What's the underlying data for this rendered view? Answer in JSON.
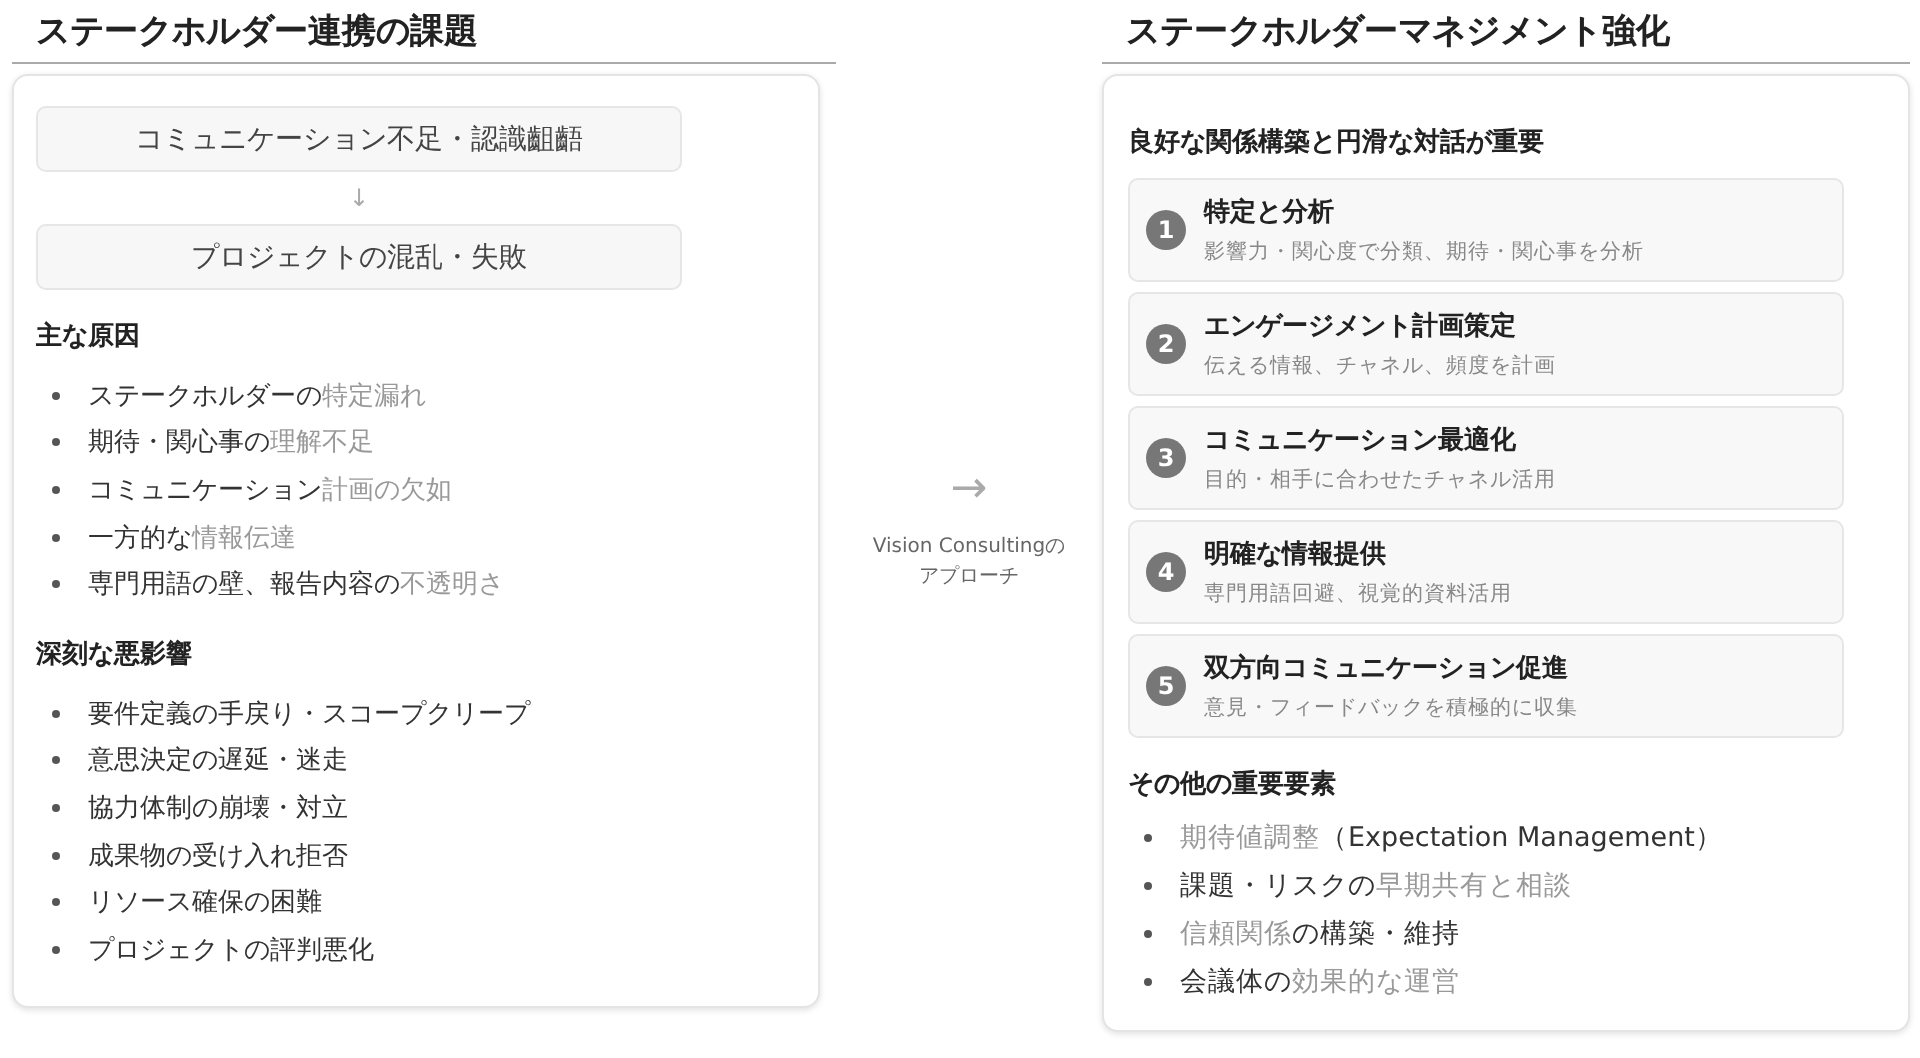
{
  "challenges": {
    "title": "ステークホルダー連携の課題",
    "flow": [
      "コミュニケーション不足・認識齟齬",
      "プロジェクトの混乱・失敗"
    ],
    "flow_arrow": "↓",
    "sections": [
      {
        "heading": "主な原因",
        "items": [
          [
            {
              "text": "ステークホルダーの",
              "highlight": false
            },
            {
              "text": "特定漏れ",
              "highlight": true
            }
          ],
          [
            {
              "text": "期待・関心事の",
              "highlight": false
            },
            {
              "text": "理解不足",
              "highlight": true
            }
          ],
          [
            {
              "text": "コミュニケーション",
              "highlight": false
            },
            {
              "text": "計画の欠如",
              "highlight": true
            }
          ],
          [
            {
              "text": "一方的な",
              "highlight": false
            },
            {
              "text": "情報伝達",
              "highlight": true
            }
          ],
          [
            {
              "text": "専門用語の壁、報告内容の",
              "highlight": false
            },
            {
              "text": "不透明さ",
              "highlight": true
            }
          ]
        ]
      },
      {
        "heading": "深刻な悪影響",
        "items": [
          [
            {
              "text": "要件定義の手戻り・スコープクリープ",
              "highlight": false
            }
          ],
          [
            {
              "text": "意思決定の遅延・迷走",
              "highlight": false
            }
          ],
          [
            {
              "text": "協力体制の崩壊・対立",
              "highlight": false
            }
          ],
          [
            {
              "text": "成果物の受け入れ拒否",
              "highlight": false
            }
          ],
          [
            {
              "text": "リソース確保の困難",
              "highlight": false
            }
          ],
          [
            {
              "text": "プロジェクトの評判悪化",
              "highlight": false
            }
          ]
        ]
      }
    ]
  },
  "transition": {
    "arrow": "→",
    "caption": [
      "Vision Consultingの",
      "アプローチ"
    ]
  },
  "management": {
    "title": "ステークホルダーマネジメント強化",
    "subtitle": "良好な関係構築と円滑な対話が重要",
    "steps": [
      {
        "number": "1",
        "title": "特定と分析",
        "description": "影響力・関心度で分類、期待・関心事を分析"
      },
      {
        "number": "2",
        "title": "エンゲージメント計画策定",
        "description": "伝える情報、チャネル、頻度を計画"
      },
      {
        "number": "3",
        "title": "コミュニケーション最適化",
        "description": "目的・相手に合わせたチャネル活用"
      },
      {
        "number": "4",
        "title": "明確な情報提供",
        "description": "専門用語回避、視覚的資料活用"
      },
      {
        "number": "5",
        "title": "双方向コミュニケーション促進",
        "description": "意見・フィードバックを積極的に収集"
      }
    ],
    "other": {
      "heading": "その他の重要要素",
      "items": [
        [
          {
            "text": "期待値調整",
            "highlight": true
          },
          {
            "text": "（Expectation Management）",
            "highlight": false
          }
        ],
        [
          {
            "text": "課題・リスクの",
            "highlight": false
          },
          {
            "text": "早期共有と相談",
            "highlight": true
          }
        ],
        [
          {
            "text": "信頼関係",
            "highlight": true
          },
          {
            "text": "の構築・維持",
            "highlight": false
          }
        ],
        [
          {
            "text": "会議体の",
            "highlight": false
          },
          {
            "text": "効果的な運営",
            "highlight": true
          }
        ]
      ]
    }
  }
}
